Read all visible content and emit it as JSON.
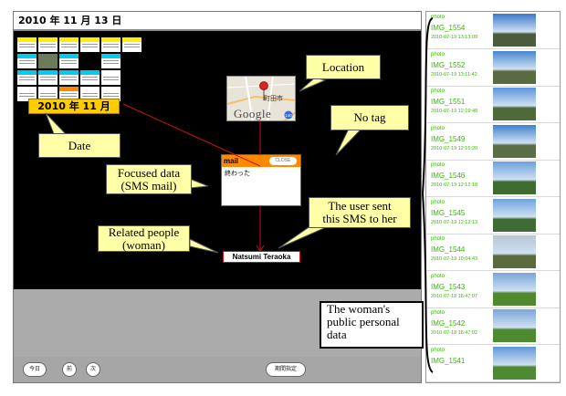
{
  "header": {
    "date": "2010 年 11 月 13 日"
  },
  "calendar": {
    "date_tag": "2010 年 11 月 13 日",
    "cells": [
      {
        "bar": "#ffee00"
      },
      {
        "bar": "#ffee00"
      },
      {
        "bar": "#ffee00"
      },
      {
        "bar": "#ffee00"
      },
      {
        "bar": "#ffee00"
      },
      {
        "bar": "#ffee00"
      },
      {
        "bar": "#00ccee"
      },
      {
        "bar": "#ffffff"
      },
      {
        "bar": "#00ccee"
      },
      {
        "bar": "#000000"
      },
      {
        "bar": "#00ccee"
      },
      {
        "bar": "#000000"
      },
      {
        "bar": "#00ccee"
      },
      {
        "bar": "#00ccee"
      },
      {
        "bar": "#00ccee"
      },
      {
        "bar": "#00ccee"
      },
      {
        "bar": "#ffffff"
      },
      {
        "bar": "#000000"
      },
      {
        "bar": "#ffffff"
      },
      {
        "bar": "#ffffff"
      },
      {
        "bar": "#ff8800"
      },
      {
        "bar": "#ffffff"
      },
      {
        "bar": "#ffffff"
      },
      {
        "bar": "#000000"
      }
    ]
  },
  "map": {
    "place": "町田市",
    "brand": "Google",
    "route": "140"
  },
  "focus": {
    "title": "mail",
    "close": "CLOSE",
    "body": "終わった"
  },
  "person": {
    "name": "Natsumi Teraoka"
  },
  "toolbar": {
    "today": "今日",
    "prev": "前",
    "next": "次",
    "period": "期間指定"
  },
  "callouts": {
    "location": "Location",
    "no_tag": "No tag",
    "date": "Date",
    "focused_1": "Focused data",
    "focused_2": "(SMS mail)",
    "sent_1": "The user sent",
    "sent_2": "this SMS to her",
    "related_1": "Related people",
    "related_2": "(woman)",
    "persondata_1": "The woman's",
    "persondata_2": "public personal",
    "persondata_3": "data"
  },
  "photos": [
    {
      "type": "photo",
      "name": "IMG_1554",
      "time": "2010-07-19 13:13:09",
      "sky": "#3b78c8",
      "land": "#4a5c3c"
    },
    {
      "type": "photo",
      "name": "IMG_1552",
      "time": "2010-07-19 13:11:42",
      "sky": "#4a86d0",
      "land": "#5a6b44"
    },
    {
      "type": "photo",
      "name": "IMG_1551",
      "time": "2010-07-19 12:19:48",
      "sky": "#5a96dd",
      "land": "#4f6a3a"
    },
    {
      "type": "photo",
      "name": "IMG_1549",
      "time": "2010-07-19 12:15:20",
      "sky": "#3f80cc",
      "land": "#5a6e46"
    },
    {
      "type": "photo",
      "name": "IMG_1546",
      "time": "2010-07-19 12:12:18",
      "sky": "#6aa0dd",
      "land": "#3e6b30"
    },
    {
      "type": "photo",
      "name": "IMG_1545",
      "time": "2010-07-19 12:12:13",
      "sky": "#6fa3de",
      "land": "#3f6c32"
    },
    {
      "type": "photo",
      "name": "IMG_1544",
      "time": "2010-07-19 10:04:43",
      "sky": "#b6c6d4",
      "land": "#5b6a3e"
    },
    {
      "type": "photo",
      "name": "IMG_1543",
      "time": "2010-07-18 16:47:07",
      "sky": "#7aa6d8",
      "land": "#4f8a2e"
    },
    {
      "type": "photo",
      "name": "IMG_1542",
      "time": "2010-07-18 16:47:02",
      "sky": "#7aa6d8",
      "land": "#4d8a30"
    },
    {
      "type": "photo",
      "name": "IMG_1541",
      "time": "",
      "sky": "#5f97d6",
      "land": "#4e8a34"
    }
  ]
}
